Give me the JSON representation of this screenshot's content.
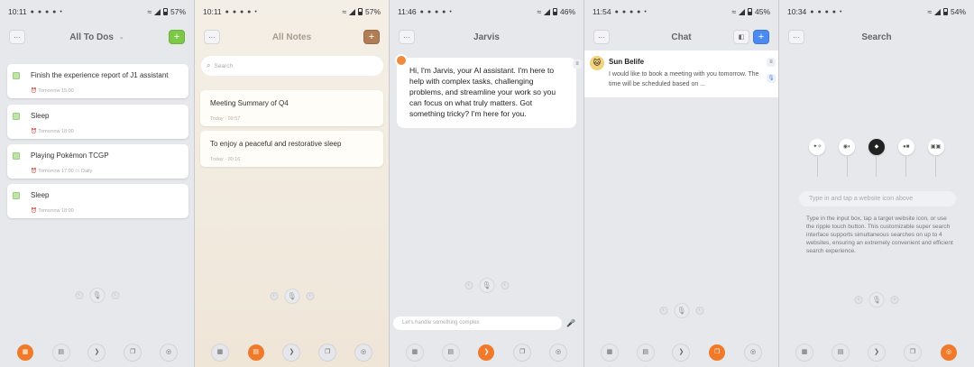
{
  "colors": {
    "accent_orange": "#f07a2a",
    "green": "#7ec848",
    "blue": "#4a8af2",
    "brown": "#b07d55"
  },
  "screens": [
    {
      "status": {
        "time": "10:11",
        "battery": "57%"
      },
      "title": "All To Dos",
      "todos": [
        {
          "text": "Finish the experience report of J1 assistant",
          "meta": "Tomorrow 15:00"
        },
        {
          "text": "Sleep",
          "meta": "Tomorrow 18:00"
        },
        {
          "text": "Playing Pokémon TCGP",
          "meta": "Tomorrow 17:00",
          "tag": "Daily"
        },
        {
          "text": "Sleep",
          "meta": "Tomorrow 18:00"
        }
      ]
    },
    {
      "status": {
        "time": "10:11",
        "battery": "57%"
      },
      "title": "All Notes",
      "search_placeholder": "Search",
      "notes": [
        {
          "text": "Meeting Summary of Q4",
          "meta": "Today · 09:57"
        },
        {
          "text": "To enjoy a peaceful and restorative sleep",
          "meta": "Today · 00:16"
        }
      ]
    },
    {
      "status": {
        "time": "11:46",
        "battery": "46%"
      },
      "title": "Jarvis",
      "message": "Hi, I'm Jarvis, your AI assistant. I'm here to help with complex tasks, challenging problems, and streamline your work so you can focus on what truly matters. Got something tricky? I'm here for you.",
      "input_placeholder": "Let's handle something complex"
    },
    {
      "status": {
        "time": "11:54",
        "battery": "45%"
      },
      "title": "Chat",
      "chat": {
        "name": "Sun Belife",
        "message": "I would like to book a meeting with you tomorrow. The time will be scheduled based on ..."
      }
    },
    {
      "status": {
        "time": "10:34",
        "battery": "54%"
      },
      "title": "Search",
      "input_placeholder": "Type in and tap a website icon above",
      "description": "Type in the input box, tap a target website icon, or use the ripple touch button. This customizable super search interface supports simultaneous searches on up to 4 websites, ensuring an extremely convenient and efficient search experience."
    }
  ]
}
